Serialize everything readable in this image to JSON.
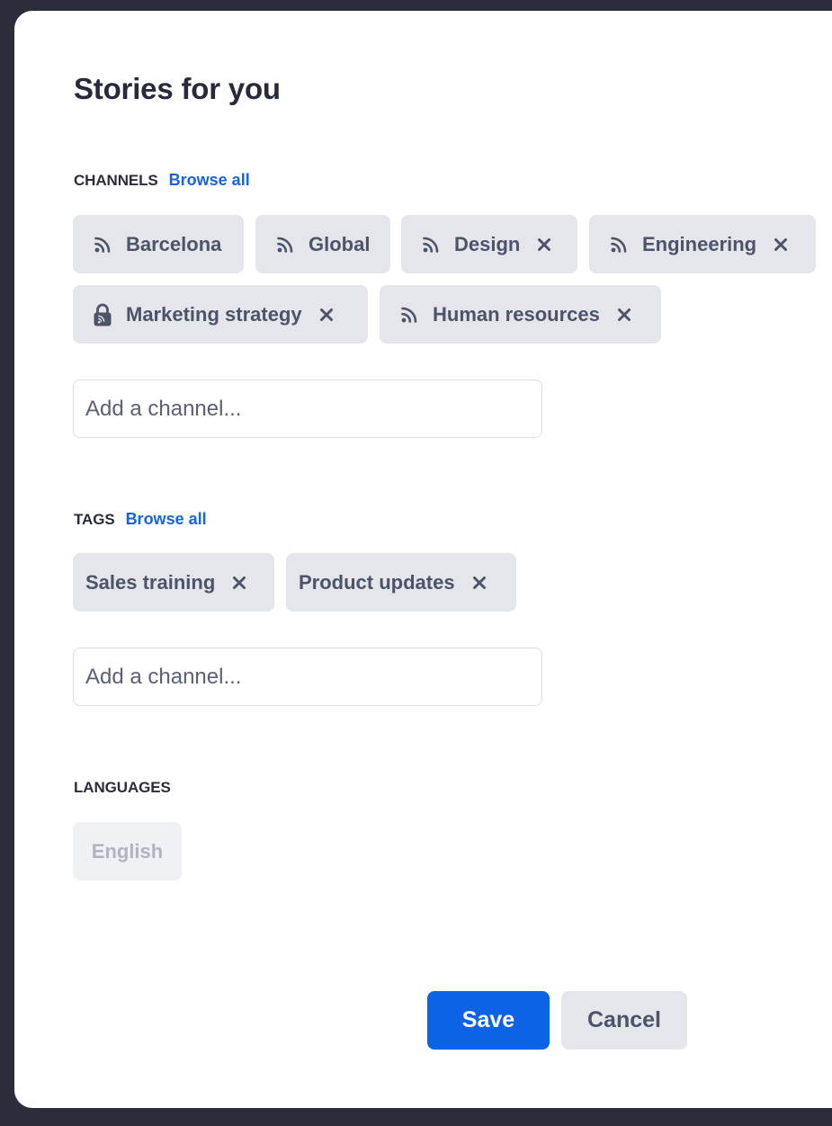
{
  "title": "Stories for you",
  "channels": {
    "label": "CHANNELS",
    "browse_label": "Browse all",
    "chips": [
      {
        "label": "Barcelona",
        "icon": "rss-icon",
        "removable": false
      },
      {
        "label": "Global",
        "icon": "rss-icon",
        "removable": false
      },
      {
        "label": "Design",
        "icon": "rss-icon",
        "removable": true
      },
      {
        "label": "Engineering",
        "icon": "rss-icon",
        "removable": true
      },
      {
        "label": "Marketing strategy",
        "icon": "lock-icon",
        "removable": true
      },
      {
        "label": "Human resources",
        "icon": "rss-icon",
        "removable": true
      }
    ],
    "input_placeholder": "Add a channel..."
  },
  "tags": {
    "label": "TAGS",
    "browse_label": "Browse all",
    "chips": [
      {
        "label": "Sales training",
        "removable": true
      },
      {
        "label": "Product updates",
        "removable": true
      }
    ],
    "input_placeholder": "Add a channel..."
  },
  "languages": {
    "label": "LANGUAGES",
    "chips": [
      {
        "label": "English",
        "disabled": true
      }
    ]
  },
  "actions": {
    "save_label": "Save",
    "cancel_label": "Cancel"
  },
  "colors": {
    "accent": "#0d63e6",
    "link": "#1565e0",
    "chip_bg": "#e5e6eb",
    "chip_text": "#4d5369",
    "backdrop": "#2b2e3a"
  }
}
